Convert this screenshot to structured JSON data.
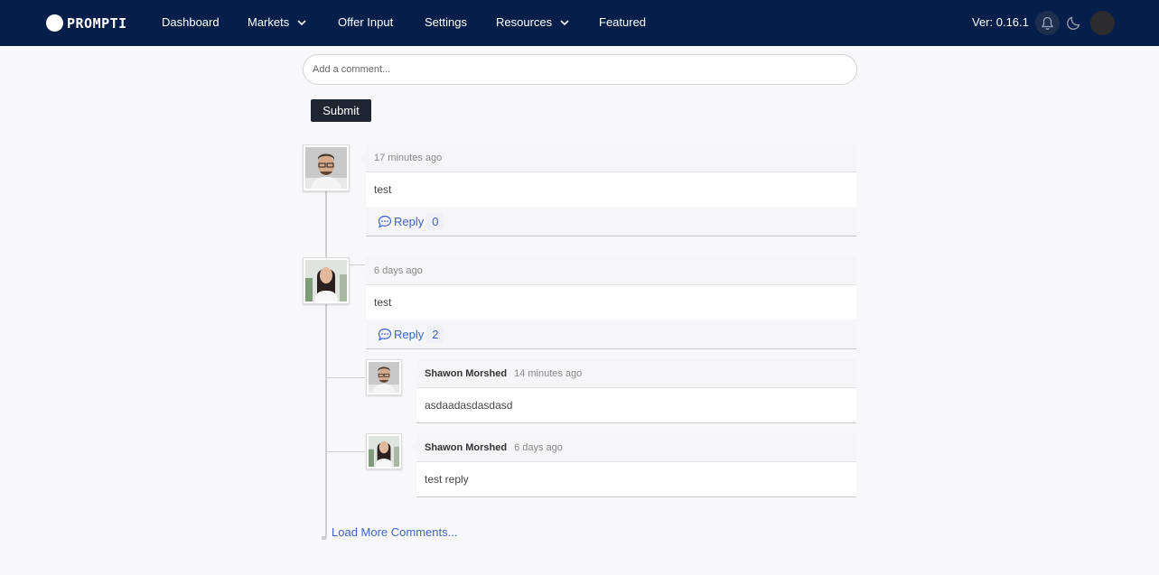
{
  "navbar": {
    "brand": "PROMPTI",
    "items": [
      {
        "label": "Dashboard",
        "dropdown": false
      },
      {
        "label": "Markets",
        "dropdown": true
      },
      {
        "label": "Offer Input",
        "dropdown": false
      },
      {
        "label": "Settings",
        "dropdown": false
      },
      {
        "label": "Resources",
        "dropdown": true
      },
      {
        "label": "Featured",
        "dropdown": false
      }
    ],
    "version": "Ver: 0.16.1",
    "icons": [
      "bell-icon",
      "moon-icon",
      "user-avatar"
    ]
  },
  "comment_form": {
    "placeholder": "Add a comment...",
    "submit_label": "Submit"
  },
  "comments": [
    {
      "time": "17 minutes ago",
      "text": "test",
      "reply_label": "Reply",
      "reply_count": "0",
      "avatar": "man"
    },
    {
      "time": "6 days ago",
      "text": "test",
      "reply_label": "Reply",
      "reply_count": "2",
      "avatar": "woman",
      "replies": [
        {
          "author": "Shawon Morshed",
          "time": "14 minutes ago",
          "text": "asdaadasdasdasd",
          "avatar": "man"
        },
        {
          "author": "Shawon Morshed",
          "time": "6 days ago",
          "text": "test reply",
          "avatar": "woman"
        }
      ]
    }
  ],
  "load_more_label": "Load More Comments...",
  "colors": {
    "navbar": "#061f4a",
    "link": "#3b64c8",
    "submit": "#202631",
    "background": "#f8f8fa"
  }
}
